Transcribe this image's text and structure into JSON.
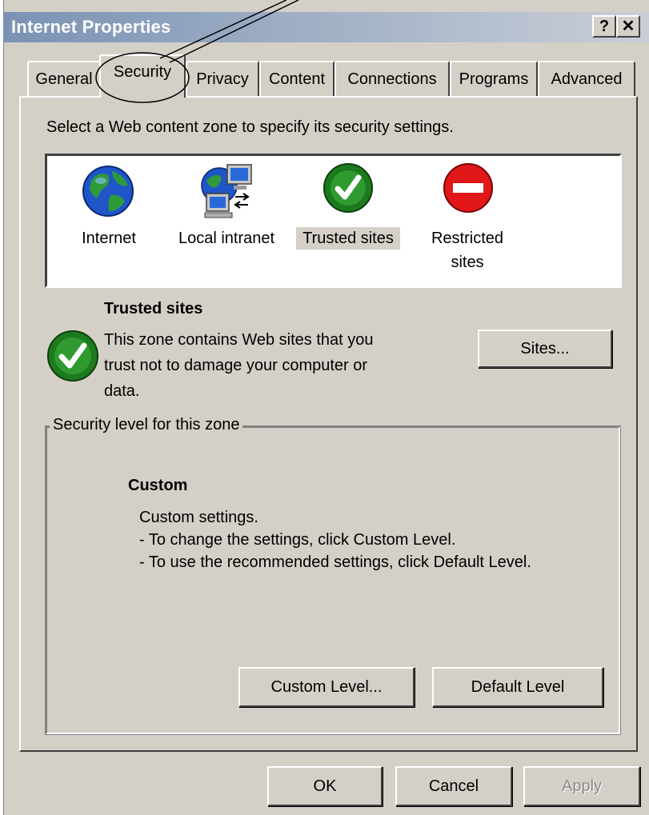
{
  "window": {
    "title": "Internet Properties",
    "help_label": "?",
    "close_label": "✕"
  },
  "tabs": [
    {
      "label": "General"
    },
    {
      "label": "Security"
    },
    {
      "label": "Privacy"
    },
    {
      "label": "Content"
    },
    {
      "label": "Connections"
    },
    {
      "label": "Programs"
    },
    {
      "label": "Advanced"
    }
  ],
  "security": {
    "instruction": "Select a Web content zone to specify its security settings.",
    "zones": [
      {
        "label": "Internet",
        "icon": "globe-icon"
      },
      {
        "label": "Local intranet",
        "icon": "intranet-icon"
      },
      {
        "label": "Trusted sites",
        "icon": "green-check-icon",
        "selected": true
      },
      {
        "label_line1": "Restricted",
        "label_line2": "sites",
        "icon": "red-no-entry-icon"
      }
    ],
    "zone_heading": "Trusted sites",
    "zone_description": [
      "This zone contains Web sites that you",
      "trust not to damage your computer or",
      "data."
    ],
    "sites_button": "Sites...",
    "level_group_label": "Security level for this zone",
    "level_name": "Custom",
    "level_description": [
      "Custom settings.",
      "- To change the settings, click Custom Level.",
      "- To use the recommended settings, click Default Level."
    ],
    "custom_level_button": "Custom Level...",
    "default_level_button": "Default Level"
  },
  "footer": {
    "ok": "OK",
    "cancel": "Cancel",
    "apply": "Apply"
  },
  "colors": {
    "dialog_bg": "#d4d0c8",
    "titlebar": "#7b92b4",
    "check_green": "#1e7a1e",
    "no_entry_red": "#e01818"
  }
}
